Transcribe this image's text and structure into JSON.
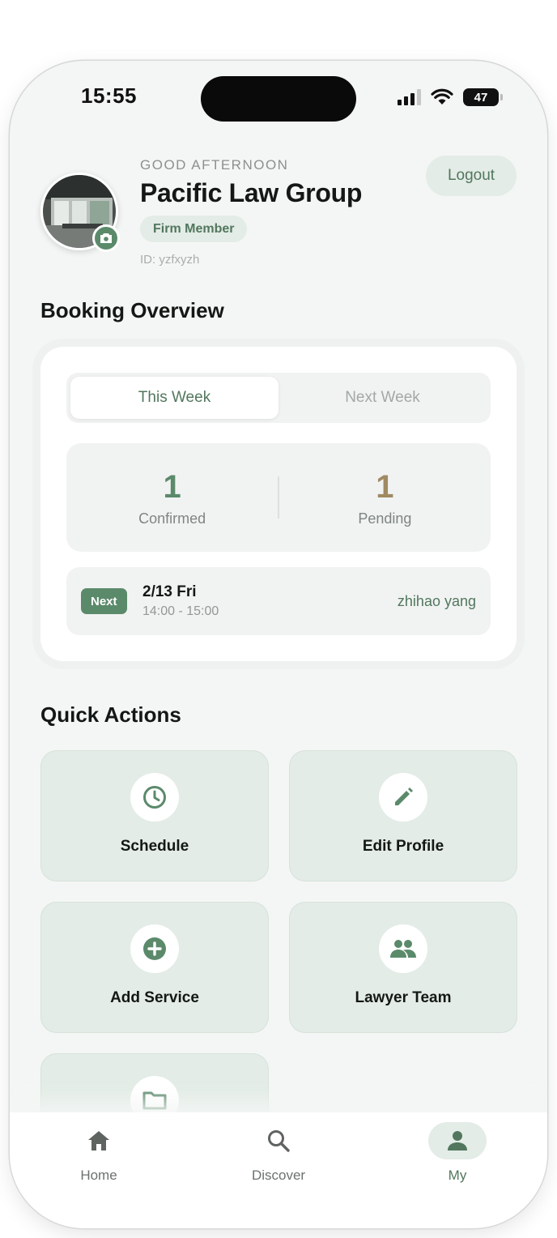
{
  "status_bar": {
    "time": "15:55",
    "battery": "47"
  },
  "profile": {
    "greeting": "GOOD AFTERNOON",
    "name": "Pacific Law Group",
    "badge": "Firm Member",
    "id_text": "ID: yzfxyzh",
    "logout_label": "Logout"
  },
  "booking": {
    "section_title": "Booking Overview",
    "tabs": [
      "This Week",
      "Next Week"
    ],
    "confirmed_count": "1",
    "confirmed_label": "Confirmed",
    "pending_count": "1",
    "pending_label": "Pending",
    "next": {
      "badge": "Next",
      "date": "2/13 Fri",
      "time": "14:00 - 15:00",
      "lawyer": "zhihao yang"
    }
  },
  "quick_actions": {
    "section_title": "Quick Actions",
    "items": [
      {
        "label": "Schedule",
        "icon": "clock-icon"
      },
      {
        "label": "Edit Profile",
        "icon": "pencil-icon"
      },
      {
        "label": "Add Service",
        "icon": "plus-circle-icon"
      },
      {
        "label": "Lawyer Team",
        "icon": "group-icon"
      },
      {
        "label": "",
        "icon": "folder-icon"
      }
    ]
  },
  "bottom_nav": {
    "items": [
      {
        "label": "Home",
        "icon": "home-icon"
      },
      {
        "label": "Discover",
        "icon": "search-icon"
      },
      {
        "label": "My",
        "icon": "person-icon"
      }
    ],
    "active": "My"
  },
  "colors": {
    "accent": "#5b8a6b",
    "accent_text": "#52775e",
    "pending": "#a08a62",
    "accent_light": "#e3ece6",
    "background": "#f4f6f5"
  }
}
